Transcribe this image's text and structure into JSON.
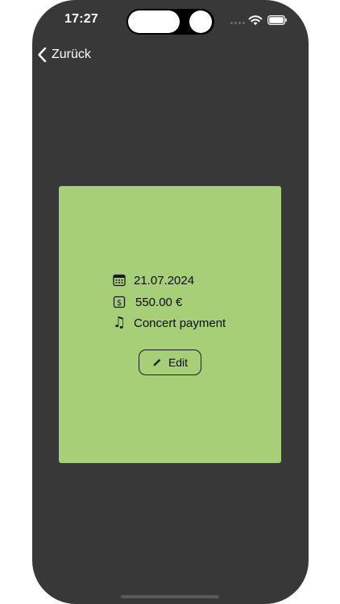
{
  "status_bar": {
    "time": "17:27"
  },
  "navigation": {
    "back_label": "Zurück",
    "back_icon": "chevron-left-icon"
  },
  "card": {
    "background_color": "#a6cf78",
    "date": "21.07.2024",
    "amount": "550.00 €",
    "description": "Concert payment",
    "description_icon": "♫",
    "edit_label": "Edit"
  },
  "colors": {
    "screen_background": "#383838",
    "card_background": "#a6cf78",
    "text_dark": "#0d0d0d",
    "text_light": "#ffffff"
  }
}
